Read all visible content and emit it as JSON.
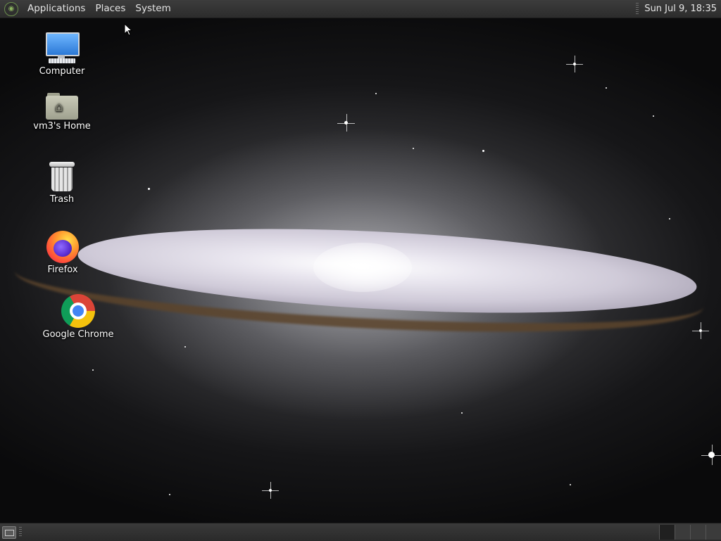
{
  "top_panel": {
    "menus": [
      "Applications",
      "Places",
      "System"
    ],
    "clock": "Sun Jul  9, 18:35"
  },
  "desktop": {
    "icons": [
      {
        "label": "Computer",
        "icon": "computer-icon"
      },
      {
        "label": "vm3's Home",
        "icon": "home-folder-icon"
      },
      {
        "label": "Trash",
        "icon": "trash-icon"
      },
      {
        "label": "Firefox",
        "icon": "firefox-icon"
      },
      {
        "label": "Google Chrome",
        "icon": "chrome-icon"
      }
    ]
  },
  "bottom_panel": {
    "show_desktop_icon": "show-desktop-icon",
    "workspace_count": 4,
    "active_workspace": 1
  }
}
